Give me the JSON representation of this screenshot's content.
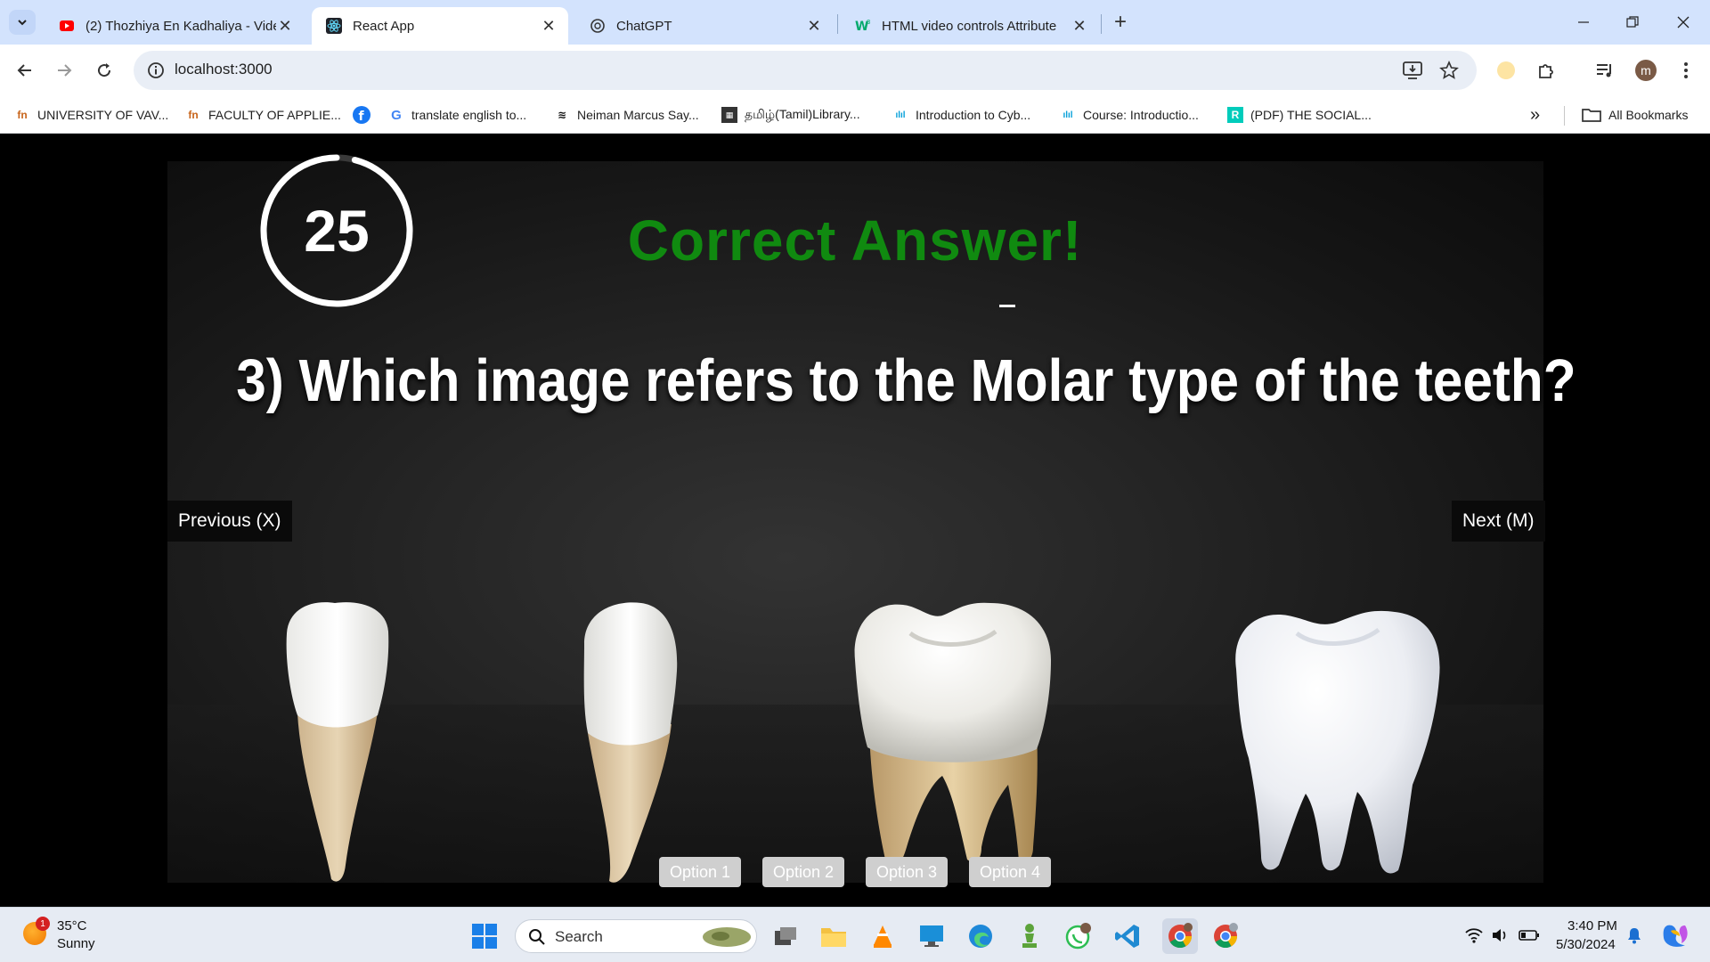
{
  "browser": {
    "tabs": [
      {
        "title": "(2) Thozhiya En Kadhaliya - Vide",
        "icon": "youtube-icon",
        "active": false
      },
      {
        "title": "React App",
        "icon": "react-icon",
        "active": true
      },
      {
        "title": "ChatGPT",
        "icon": "chatgpt-icon",
        "active": false
      },
      {
        "title": "HTML video controls Attribute",
        "icon": "w3schools-icon",
        "active": false
      }
    ],
    "url": "localhost:3000",
    "bookmarks": [
      {
        "label": "UNIVERSITY OF VAV...",
        "icon": "faculty-icon"
      },
      {
        "label": "FACULTY OF APPLIE...",
        "icon": "faculty-icon"
      },
      {
        "label": "",
        "icon": "facebook-icon"
      },
      {
        "label": "translate english to...",
        "icon": "google-icon"
      },
      {
        "label": "Neiman Marcus Say...",
        "icon": "neiman-icon"
      },
      {
        "label": "தமிழ்(Tamil)Library...",
        "icon": "tamil-icon"
      },
      {
        "label": "Introduction to Cyb...",
        "icon": "cisco-icon"
      },
      {
        "label": "Course: Introductio...",
        "icon": "cisco-icon"
      },
      {
        "label": "(PDF) THE SOCIAL...",
        "icon": "researchgate-icon"
      }
    ],
    "all_bookmarks": "All Bookmarks",
    "profile_initial": "m"
  },
  "quiz": {
    "timer": "25",
    "timer_progress": 0.96,
    "result": "Correct Answer!",
    "question": "3) Which image refers to the Molar type of the teeth?",
    "previous_label": "Previous (X)",
    "next_label": "Next (M)",
    "options": [
      "Option 1",
      "Option 2",
      "Option 3",
      "Option 4"
    ],
    "colors": {
      "result": "#108a10",
      "option_bg": "#cfcfcf"
    }
  },
  "taskbar": {
    "temperature": "35°C",
    "weather": "Sunny",
    "weather_badge": "1",
    "search": "Search",
    "time": "3:40 PM",
    "date": "5/30/2024"
  }
}
